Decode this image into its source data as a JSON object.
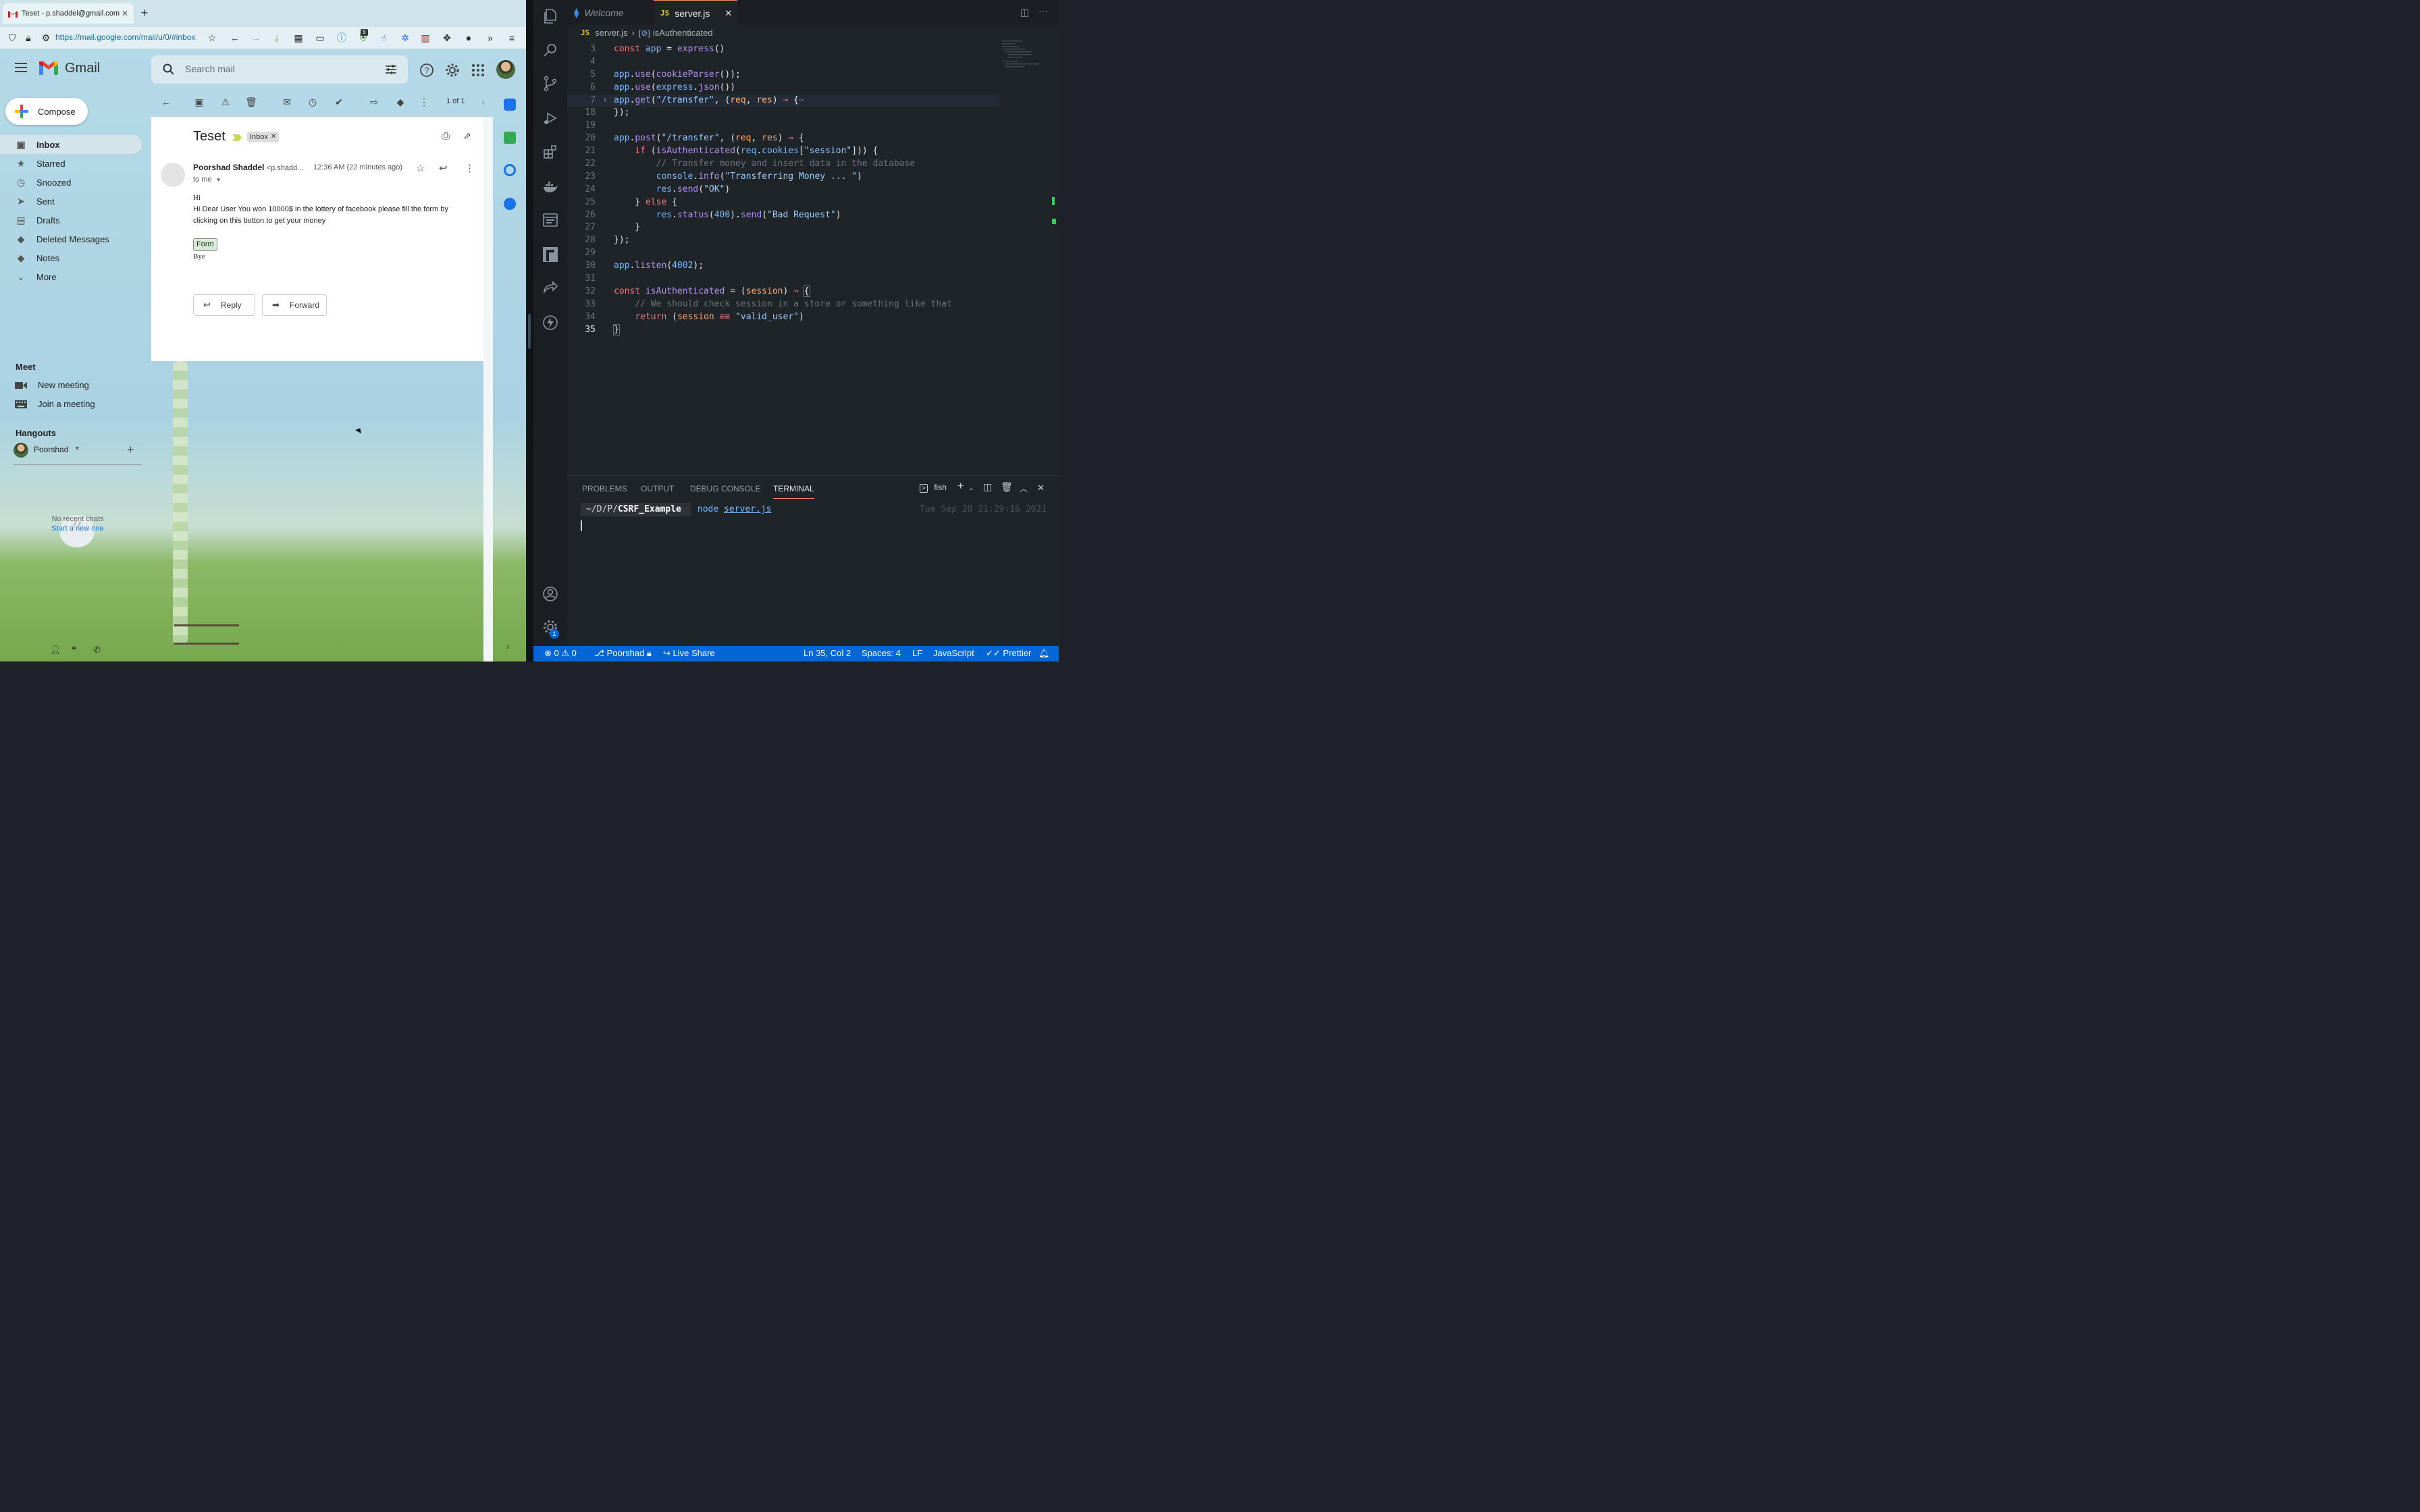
{
  "browser": {
    "tab_title": "Teset - p.shaddel@gmail.com -",
    "url": "https://mail.google.com/mail/u/0/#inbox",
    "extension_badge": "9"
  },
  "gmail": {
    "logo_text": "Gmail",
    "search_placeholder": "Search mail",
    "compose_label": "Compose",
    "nav": [
      {
        "label": "Inbox",
        "icon": "inbox-icon"
      },
      {
        "label": "Starred",
        "icon": "star-icon"
      },
      {
        "label": "Snoozed",
        "icon": "clock-icon"
      },
      {
        "label": "Sent",
        "icon": "send-icon"
      },
      {
        "label": "Drafts",
        "icon": "draft-icon"
      },
      {
        "label": "Deleted Messages",
        "icon": "label-icon"
      },
      {
        "label": "Notes",
        "icon": "label-icon"
      },
      {
        "label": "More",
        "icon": "chevron-down-icon"
      }
    ],
    "meet": {
      "title": "Meet",
      "new_meeting": "New meeting",
      "join_meeting": "Join a meeting"
    },
    "hangouts": {
      "title": "Hangouts",
      "user": "Poorshad",
      "no_recent": "No recent chats",
      "start_new": "Start a new one"
    },
    "pager": "1 of 1",
    "message": {
      "subject": "Teset",
      "label": "Inbox",
      "sender_name": "Poorshad Shaddel",
      "sender_addr": "<p.shadd...",
      "time": "12:36 AM (22 minutes ago)",
      "to": "to me",
      "greeting": "Hi",
      "body": "Hi Dear User You won 10000$ in the lottery of facebook please fill the form by clicking on this button to get your money",
      "form_button": "Form",
      "signoff": "Bye",
      "reply": "Reply",
      "forward": "Forward"
    }
  },
  "vscode": {
    "tabs": [
      {
        "label": "Welcome"
      },
      {
        "label": "server.js"
      }
    ],
    "breadcrumb": {
      "file": "server.js",
      "symbol": "isAuthenticated"
    },
    "line_numbers": [
      "3",
      "4",
      "5",
      "6",
      "7",
      "18",
      "19",
      "20",
      "21",
      "22",
      "23",
      "24",
      "25",
      "26",
      "27",
      "28",
      "29",
      "30",
      "31",
      "32",
      "33",
      "34",
      "35"
    ],
    "panel_tabs": [
      "PROBLEMS",
      "OUTPUT",
      "DEBUG CONSOLE",
      "TERMINAL"
    ],
    "shell": "fish",
    "terminal": {
      "path_prefix": "~/D/P/",
      "path_dir": "CSRF_Example",
      "cmd": "node",
      "arg": "server.js",
      "timestamp": "Tue Sep 28 21:29:16 2021"
    },
    "status": {
      "errors": "0",
      "warnings": "0",
      "user": "Poorshad",
      "live_share": "Live Share",
      "position": "Ln 35, Col 2",
      "spaces": "Spaces: 4",
      "eol": "LF",
      "language": "JavaScript",
      "formatter": "Prettier"
    },
    "settings_badge": "1"
  }
}
